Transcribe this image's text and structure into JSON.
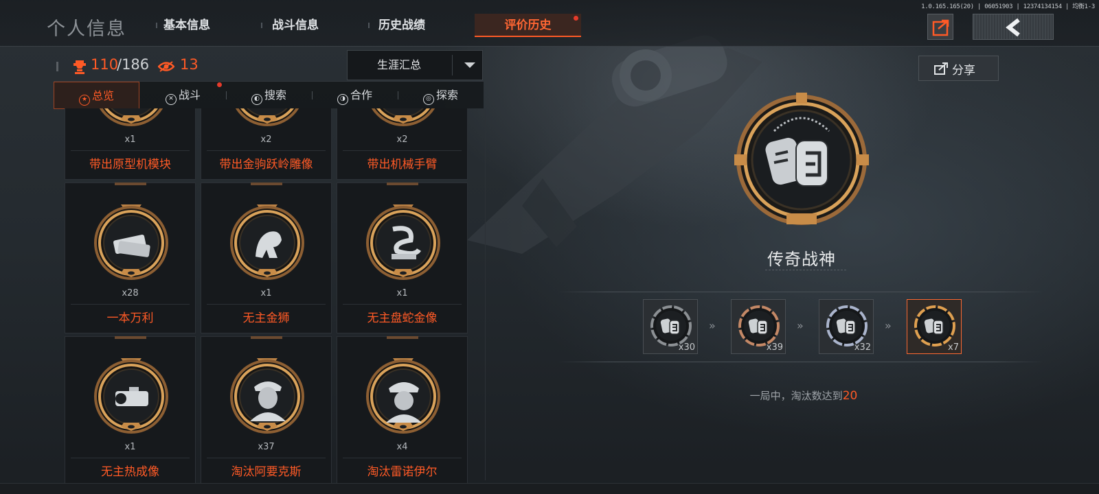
{
  "header": {
    "title": "个人信息",
    "version_text": "1.0.165.165(20) | 06051903 | 12374134154 | 均衡1-3",
    "tabs": [
      {
        "label": "基本信息",
        "active": false,
        "notification": false
      },
      {
        "label": "战斗信息",
        "active": false,
        "notification": false
      },
      {
        "label": "历史战绩",
        "active": false,
        "notification": false
      },
      {
        "label": "评价历史",
        "active": true,
        "notification": true
      }
    ],
    "export_icon": "export-icon",
    "back_icon": "chevron-left-icon"
  },
  "stats": {
    "earned": "110",
    "total": "/186",
    "views": "13",
    "trophy_icon": "trophy-icon",
    "eye_icon": "eye-icon"
  },
  "filter": {
    "selected": "生涯汇总"
  },
  "subtabs": [
    {
      "label": "总览",
      "icon": "star-circle-icon",
      "active": true,
      "notification": false
    },
    {
      "label": "战斗",
      "icon": "crossed-swords-icon",
      "active": false,
      "notification": true
    },
    {
      "label": "搜索",
      "icon": "search-circle-icon",
      "active": false,
      "notification": false
    },
    {
      "label": "合作",
      "icon": "handshake-icon",
      "active": false,
      "notification": false
    },
    {
      "label": "探索",
      "icon": "compass-icon",
      "active": false,
      "notification": false
    }
  ],
  "achievements": [
    {
      "name": "带出原型机模块",
      "count": "x1",
      "icon": "prototype-module-icon"
    },
    {
      "name": "带出金驹跃岭雕像",
      "count": "x2",
      "icon": "golden-horse-statue-icon"
    },
    {
      "name": "带出机械手臂",
      "count": "x2",
      "icon": "mechanical-arm-icon"
    },
    {
      "name": "一本万利",
      "count": "x28",
      "icon": "cash-stack-icon"
    },
    {
      "name": "无主金狮",
      "count": "x1",
      "icon": "golden-lion-icon"
    },
    {
      "name": "无主盘蛇金像",
      "count": "x1",
      "icon": "coiled-snake-statue-icon"
    },
    {
      "name": "无主热成像",
      "count": "x1",
      "icon": "thermal-scope-icon"
    },
    {
      "name": "淘汰阿要克斯",
      "count": "x37",
      "icon": "soldier-portrait-icon"
    },
    {
      "name": "淘汰雷诺伊尔",
      "count": "x4",
      "icon": "officer-portrait-icon"
    }
  ],
  "detail": {
    "share_label": "分享",
    "share_icon": "share-icon",
    "title": "传奇战神",
    "medal_icon": "dog-tags-icon",
    "tiers": [
      {
        "count": "x30",
        "tier": "black",
        "color": "#8c9094"
      },
      {
        "count": "x39",
        "tier": "bronze",
        "color": "#c48866"
      },
      {
        "count": "x32",
        "tier": "silver",
        "color": "#aab4cc"
      },
      {
        "count": "x7",
        "tier": "gold",
        "color": "#e0a050",
        "active": true
      }
    ],
    "condition_prefix": "一局中，淘汰数达到",
    "condition_value": "20"
  },
  "colors": {
    "accent": "#ff5a26",
    "gold": "#c9924a",
    "notification": "#e53b2b"
  }
}
